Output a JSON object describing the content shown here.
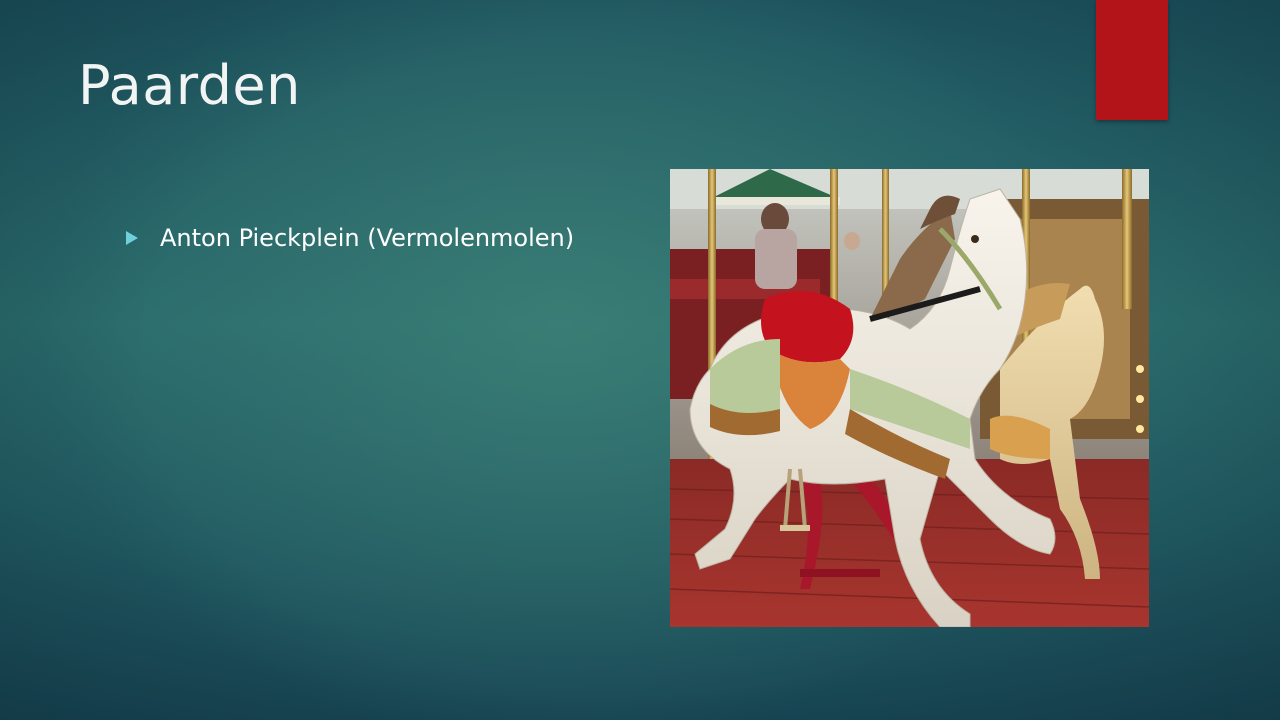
{
  "slide": {
    "title": "Paarden",
    "bullets": [
      "Anton Pieckplein (Vermolenmolen)"
    ],
    "accent_color": "#b3141a",
    "bullet_color": "#6fd0dc"
  },
  "image": {
    "subject": "carousel horses"
  }
}
